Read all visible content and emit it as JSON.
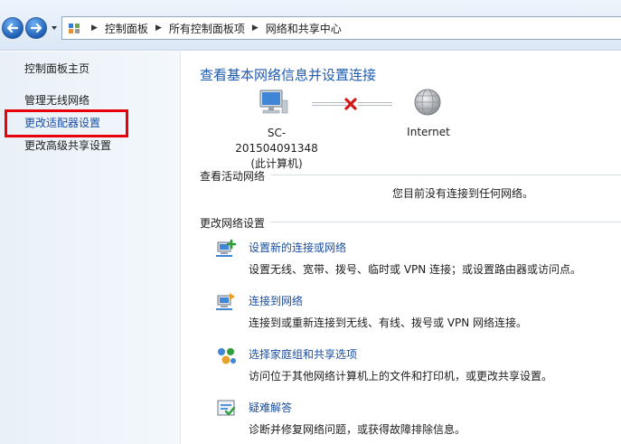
{
  "address": {
    "crumbs": [
      "控制面板",
      "所有控制面板项",
      "网络和共享中心"
    ]
  },
  "sidebar": {
    "home": "控制面板主页",
    "items": [
      "管理无线网络",
      "更改适配器设置",
      "更改高级共享设置"
    ]
  },
  "main": {
    "title": "查看基本网络信息并设置连接",
    "computer_name": "SC-201504091348",
    "computer_sub": "(此计算机)",
    "internet_label": "Internet",
    "active_header": "查看活动网络",
    "no_connection": "您目前没有连接到任何网络。",
    "change_header": "更改网络设置",
    "tasks": [
      {
        "link": "设置新的连接或网络",
        "desc": "设置无线、宽带、拨号、临时或 VPN 连接；或设置路由器或访问点。"
      },
      {
        "link": "连接到网络",
        "desc": "连接到或重新连接到无线、有线、拨号或 VPN 网络连接。"
      },
      {
        "link": "选择家庭组和共享选项",
        "desc": "访问位于其他网络计算机上的文件和打印机，或更改共享设置。"
      },
      {
        "link": "疑难解答",
        "desc": "诊断并修复网络问题，或获得故障排除信息。"
      }
    ]
  },
  "colors": {
    "accent": "#1f5bb0",
    "link": "#1a4fa0",
    "highlight": "#e8000b",
    "error": "#d21a1a"
  }
}
